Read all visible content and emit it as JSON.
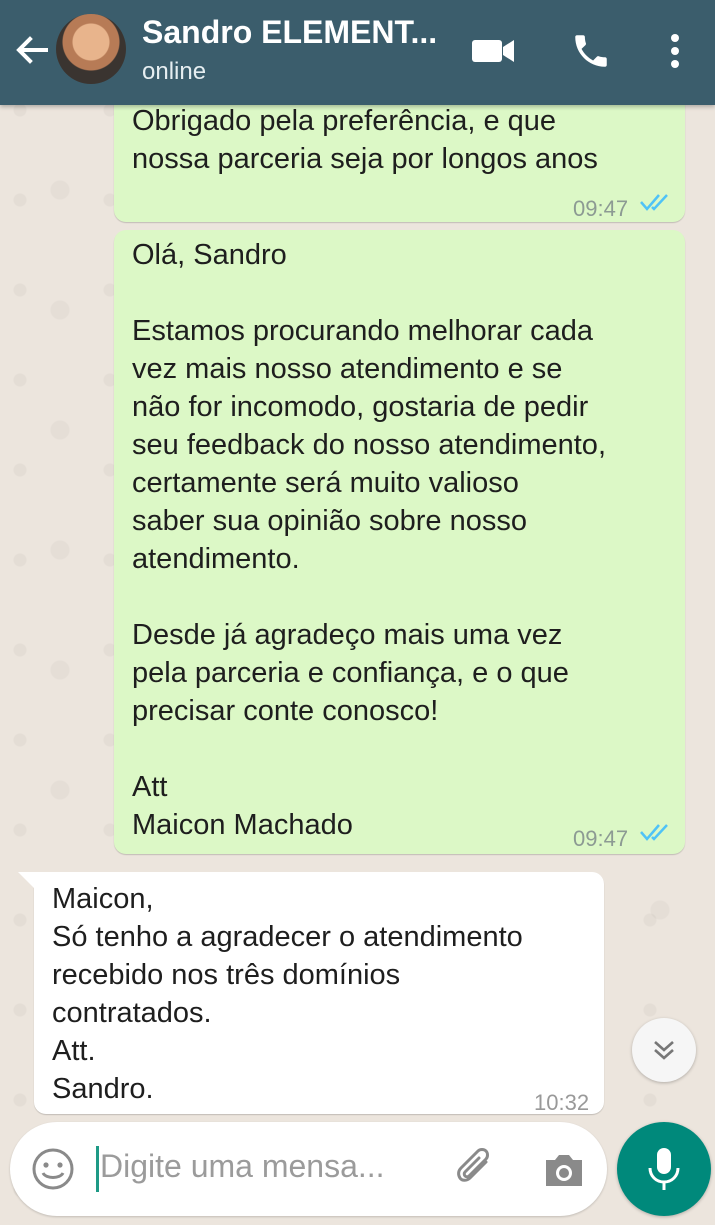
{
  "header": {
    "contact_name": "Sandro ELEMENT...",
    "status": "online"
  },
  "messages": [
    {
      "direction": "outgoing",
      "lines": [
        "Obrigado pela preferência, e que",
        "nossa parceria seja por longos anos"
      ],
      "time": "09:47",
      "read": true
    },
    {
      "direction": "outgoing",
      "lines": [
        "Olá, Sandro",
        "",
        "Estamos procurando melhorar cada",
        "vez mais nosso atendimento e se",
        "não for incomodo, gostaria de pedir",
        "seu feedback do nosso atendimento,",
        "certamente será muito valioso",
        "saber sua opinião sobre nosso",
        "atendimento.",
        "",
        "Desde já agradeço mais uma vez",
        "pela parceria e confiança, e o que",
        "precisar conte conosco!",
        "",
        "Att",
        "Maicon Machado"
      ],
      "time": "09:47",
      "read": true
    },
    {
      "direction": "incoming",
      "lines": [
        "Maicon,",
        "Só tenho a agradecer o atendimento",
        "recebido nos três domínios",
        "contratados.",
        "Att.",
        "Sandro."
      ],
      "time": "10:32"
    }
  ],
  "composer": {
    "placeholder": "Digite uma mensa..."
  },
  "colors": {
    "header": "#3b5d6c",
    "outgoing_bubble": "#dcf8c6",
    "incoming_bubble": "#ffffff",
    "read_ticks": "#4fc3f7",
    "mic_button": "#00897b"
  },
  "icons": [
    "back-arrow-icon",
    "video-call-icon",
    "phone-icon",
    "more-vert-icon",
    "double-check-icon",
    "chevron-double-down-icon",
    "emoji-icon",
    "paperclip-icon",
    "camera-icon",
    "mic-icon"
  ]
}
